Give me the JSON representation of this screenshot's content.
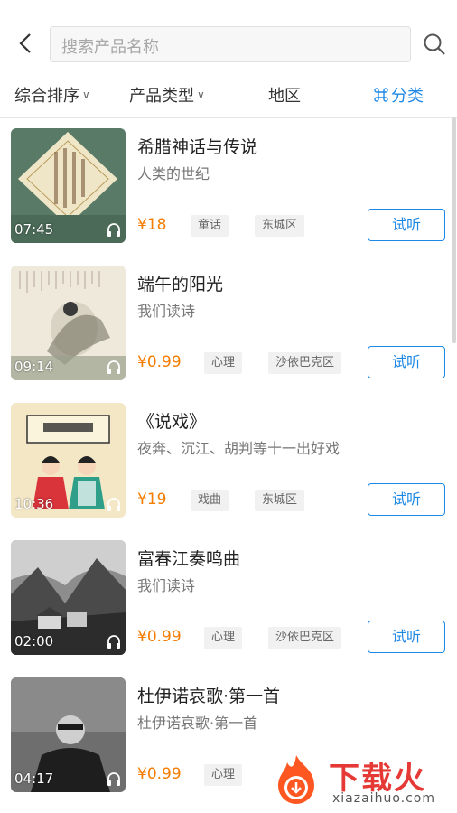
{
  "header": {
    "search_placeholder": "搜索产品名称",
    "icons": {
      "back": "chevron-left-icon",
      "search": "search-icon"
    }
  },
  "filters": {
    "sort": "综合排序",
    "type": "产品类型",
    "region": "地区",
    "category": "分类",
    "accent_color": "#1e88e5"
  },
  "items": [
    {
      "title": "希腊神话与传说",
      "subtitle": "人类的世纪",
      "duration": "07:45",
      "price": "¥18",
      "tag1": "童话",
      "tag2": "东城区",
      "action": "试听"
    },
    {
      "title": "端午的阳光",
      "subtitle": "我们读诗",
      "duration": "09:14",
      "price": "¥0.99",
      "tag1": "心理",
      "tag2": "沙依巴克区",
      "action": "试听"
    },
    {
      "title": "《说戏》",
      "subtitle": "夜奔、沉江、胡判等十一出好戏",
      "duration": "10:36",
      "price": "¥19",
      "tag1": "戏曲",
      "tag2": "东城区",
      "action": "试听"
    },
    {
      "title": "富春江奏鸣曲",
      "subtitle": "我们读诗",
      "duration": "02:00",
      "price": "¥0.99",
      "tag1": "心理",
      "tag2": "沙依巴克区",
      "action": "试听"
    },
    {
      "title": "杜伊诺哀歌·第一首",
      "subtitle": "杜伊诺哀歌·第一首",
      "duration": "04:17",
      "price": "¥0.99",
      "tag1": "心理",
      "tag2": "",
      "action": ""
    }
  ],
  "watermark": {
    "brand": "下载火",
    "domain": "xiazaihuo.com"
  },
  "colors": {
    "price": "#f57c00",
    "button": "#1e88e5"
  }
}
